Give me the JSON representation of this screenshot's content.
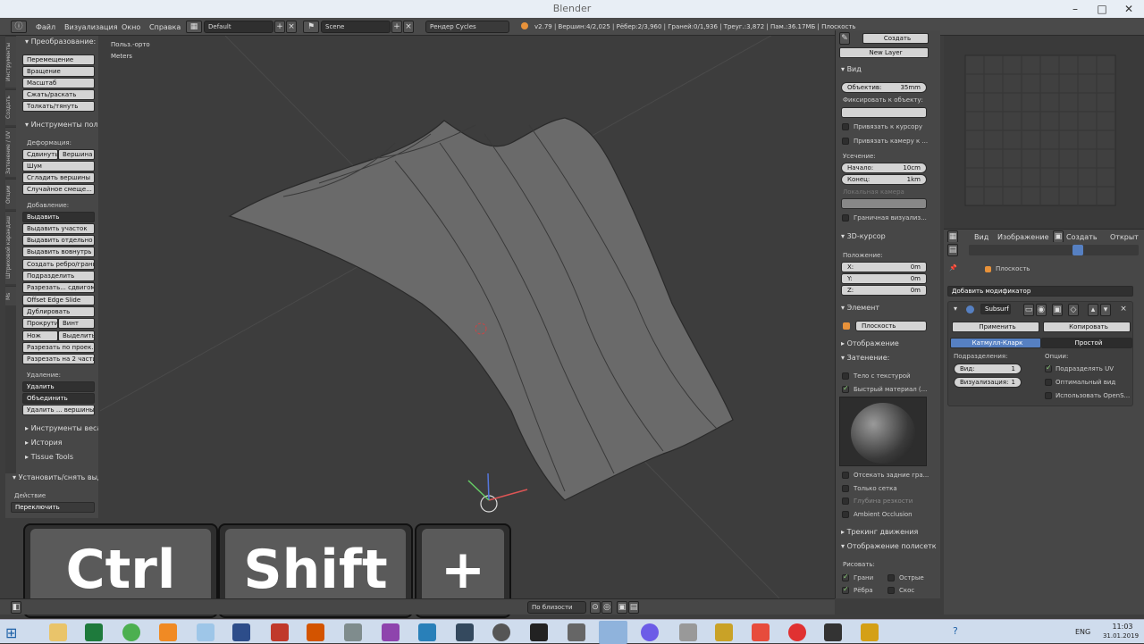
{
  "window": {
    "title": "Blender"
  },
  "menu": {
    "file": "Файл",
    "render_menu": "Визуализация",
    "window": "Окно",
    "help": "Справка"
  },
  "screen_layout": "Default",
  "scene": "Scene",
  "render_engine": "Рендер Cycles",
  "stats": "v2.79 | Вершин:4/2,025 | Рёбер:2/3,960 | Граней:0/1,936 | Треуг.:3,872 | Пам.:36.17MБ | Плоскость",
  "toolshelf": {
    "tabs": [
      "Инструменты",
      "Создать",
      "Затенение / UV",
      "Опции",
      "Штриховой карандаш",
      "Ms"
    ],
    "transform_header": "Преобразование:",
    "transform_buttons": [
      "Перемещение",
      "Вращение",
      "Масштаб",
      "Сжать/раскать",
      "Толкать/тянуть"
    ],
    "mesh_tools_header": "Инструменты поли",
    "deform_label": "Деформация:",
    "slide_left": "Сдвинуть",
    "slide_right": "Вершина",
    "deform_buttons": [
      "Шум",
      "Сгладить вершины",
      "Случайное смеще..."
    ],
    "add_label": "Добавление:",
    "extrude": "Выдавить",
    "add_buttons": [
      "Выдавить участок",
      "Выдавить отдельно",
      "Выдавить вовнутрь",
      "Создать ребро/грань",
      "Подразделить",
      "Разрезать... сдвигом",
      "Offset Edge Slide",
      "Дублировать"
    ],
    "spin_left": "Прокрутить",
    "spin_right": "Винт",
    "knife_left": "Нож",
    "knife_right": "Выделить",
    "add_buttons2": [
      "Разрезать по проек...",
      "Разрезать на 2 части"
    ],
    "remove_label": "Удаление:",
    "delete": "Удалить",
    "merge": "Объединить",
    "remove_doubles": "Удалить ... вершины",
    "weight_tools": "Инструменты веса",
    "history": "История",
    "tissue_tools": "Tissue Tools",
    "toggle_header": "Установить/снять выд",
    "action_label": "Действие",
    "action_value": "Переключить"
  },
  "viewport": {
    "view_name": "Польз.-орто",
    "units": "Meters"
  },
  "viewport_footer": {
    "snap": "По близости"
  },
  "keys": [
    "Ctrl",
    "Shift",
    "+"
  ],
  "npanel": {
    "create": "Создать",
    "new_layer": "New Layer",
    "view_header": "Вид",
    "lens_label": "Объектив:",
    "lens_value": "35mm",
    "lock_label": "Фиксировать к объекту:",
    "lock_cursor": "Привязать к курсору",
    "lock_camera": "Привязать камеру к ...",
    "clip_label": "Усечение:",
    "clip_start_label": "Начало:",
    "clip_start": "10cm",
    "clip_end_label": "Конец:",
    "clip_end": "1km",
    "local_camera": "Локальная камера",
    "render_border": "Граничная визуализ...",
    "cursor_header": "3D-курсор",
    "location_label": "Положение:",
    "x_label": "X:",
    "x": "0m",
    "y_label": "Y:",
    "y": "0m",
    "z_label": "Z:",
    "z": "0m",
    "item_header": "Элемент",
    "item_name": "Плоскость",
    "display_header": "Отображение",
    "shading_header": "Затенение:",
    "textured_solid": "Тело с текстурой",
    "matcap": "Быстрый материал (...",
    "backface": "Отсекать задние гра...",
    "only_render": "Только сетка",
    "dof": "Глубина резкости",
    "ao": "Ambient Occlusion",
    "motion_tracking": "Трекинг движения",
    "mesh_display": "Отображение полисетк",
    "draw_label": "Рисовать:",
    "faces": "Грани",
    "edges": "Рёбра",
    "creases": "Острые",
    "sharp": "Скос"
  },
  "uv_header": {
    "view": "Вид",
    "image": "Изображение",
    "new": "Создать",
    "open": "Открыт"
  },
  "properties": {
    "object_name": "Плоскость",
    "add_modifier": "Добавить модификатор",
    "modifier_name": "Subsurf",
    "apply": "Применить",
    "copy": "Копировать",
    "catmull": "Катмулл-Кларк",
    "simple": "Простой",
    "subdivisions": "Подразделения:",
    "view_label": "Вид:",
    "view_value": "1",
    "render_label": "Визуализация:",
    "render_value": "1",
    "options": "Опции:",
    "subdivide_uv": "Подразделять UV",
    "optimal": "Оптимальный вид",
    "opensubdiv": "Использовать OpenS..."
  },
  "taskbar": {
    "lang": "ENG",
    "time": "11:03",
    "date": "31.01.2019"
  }
}
